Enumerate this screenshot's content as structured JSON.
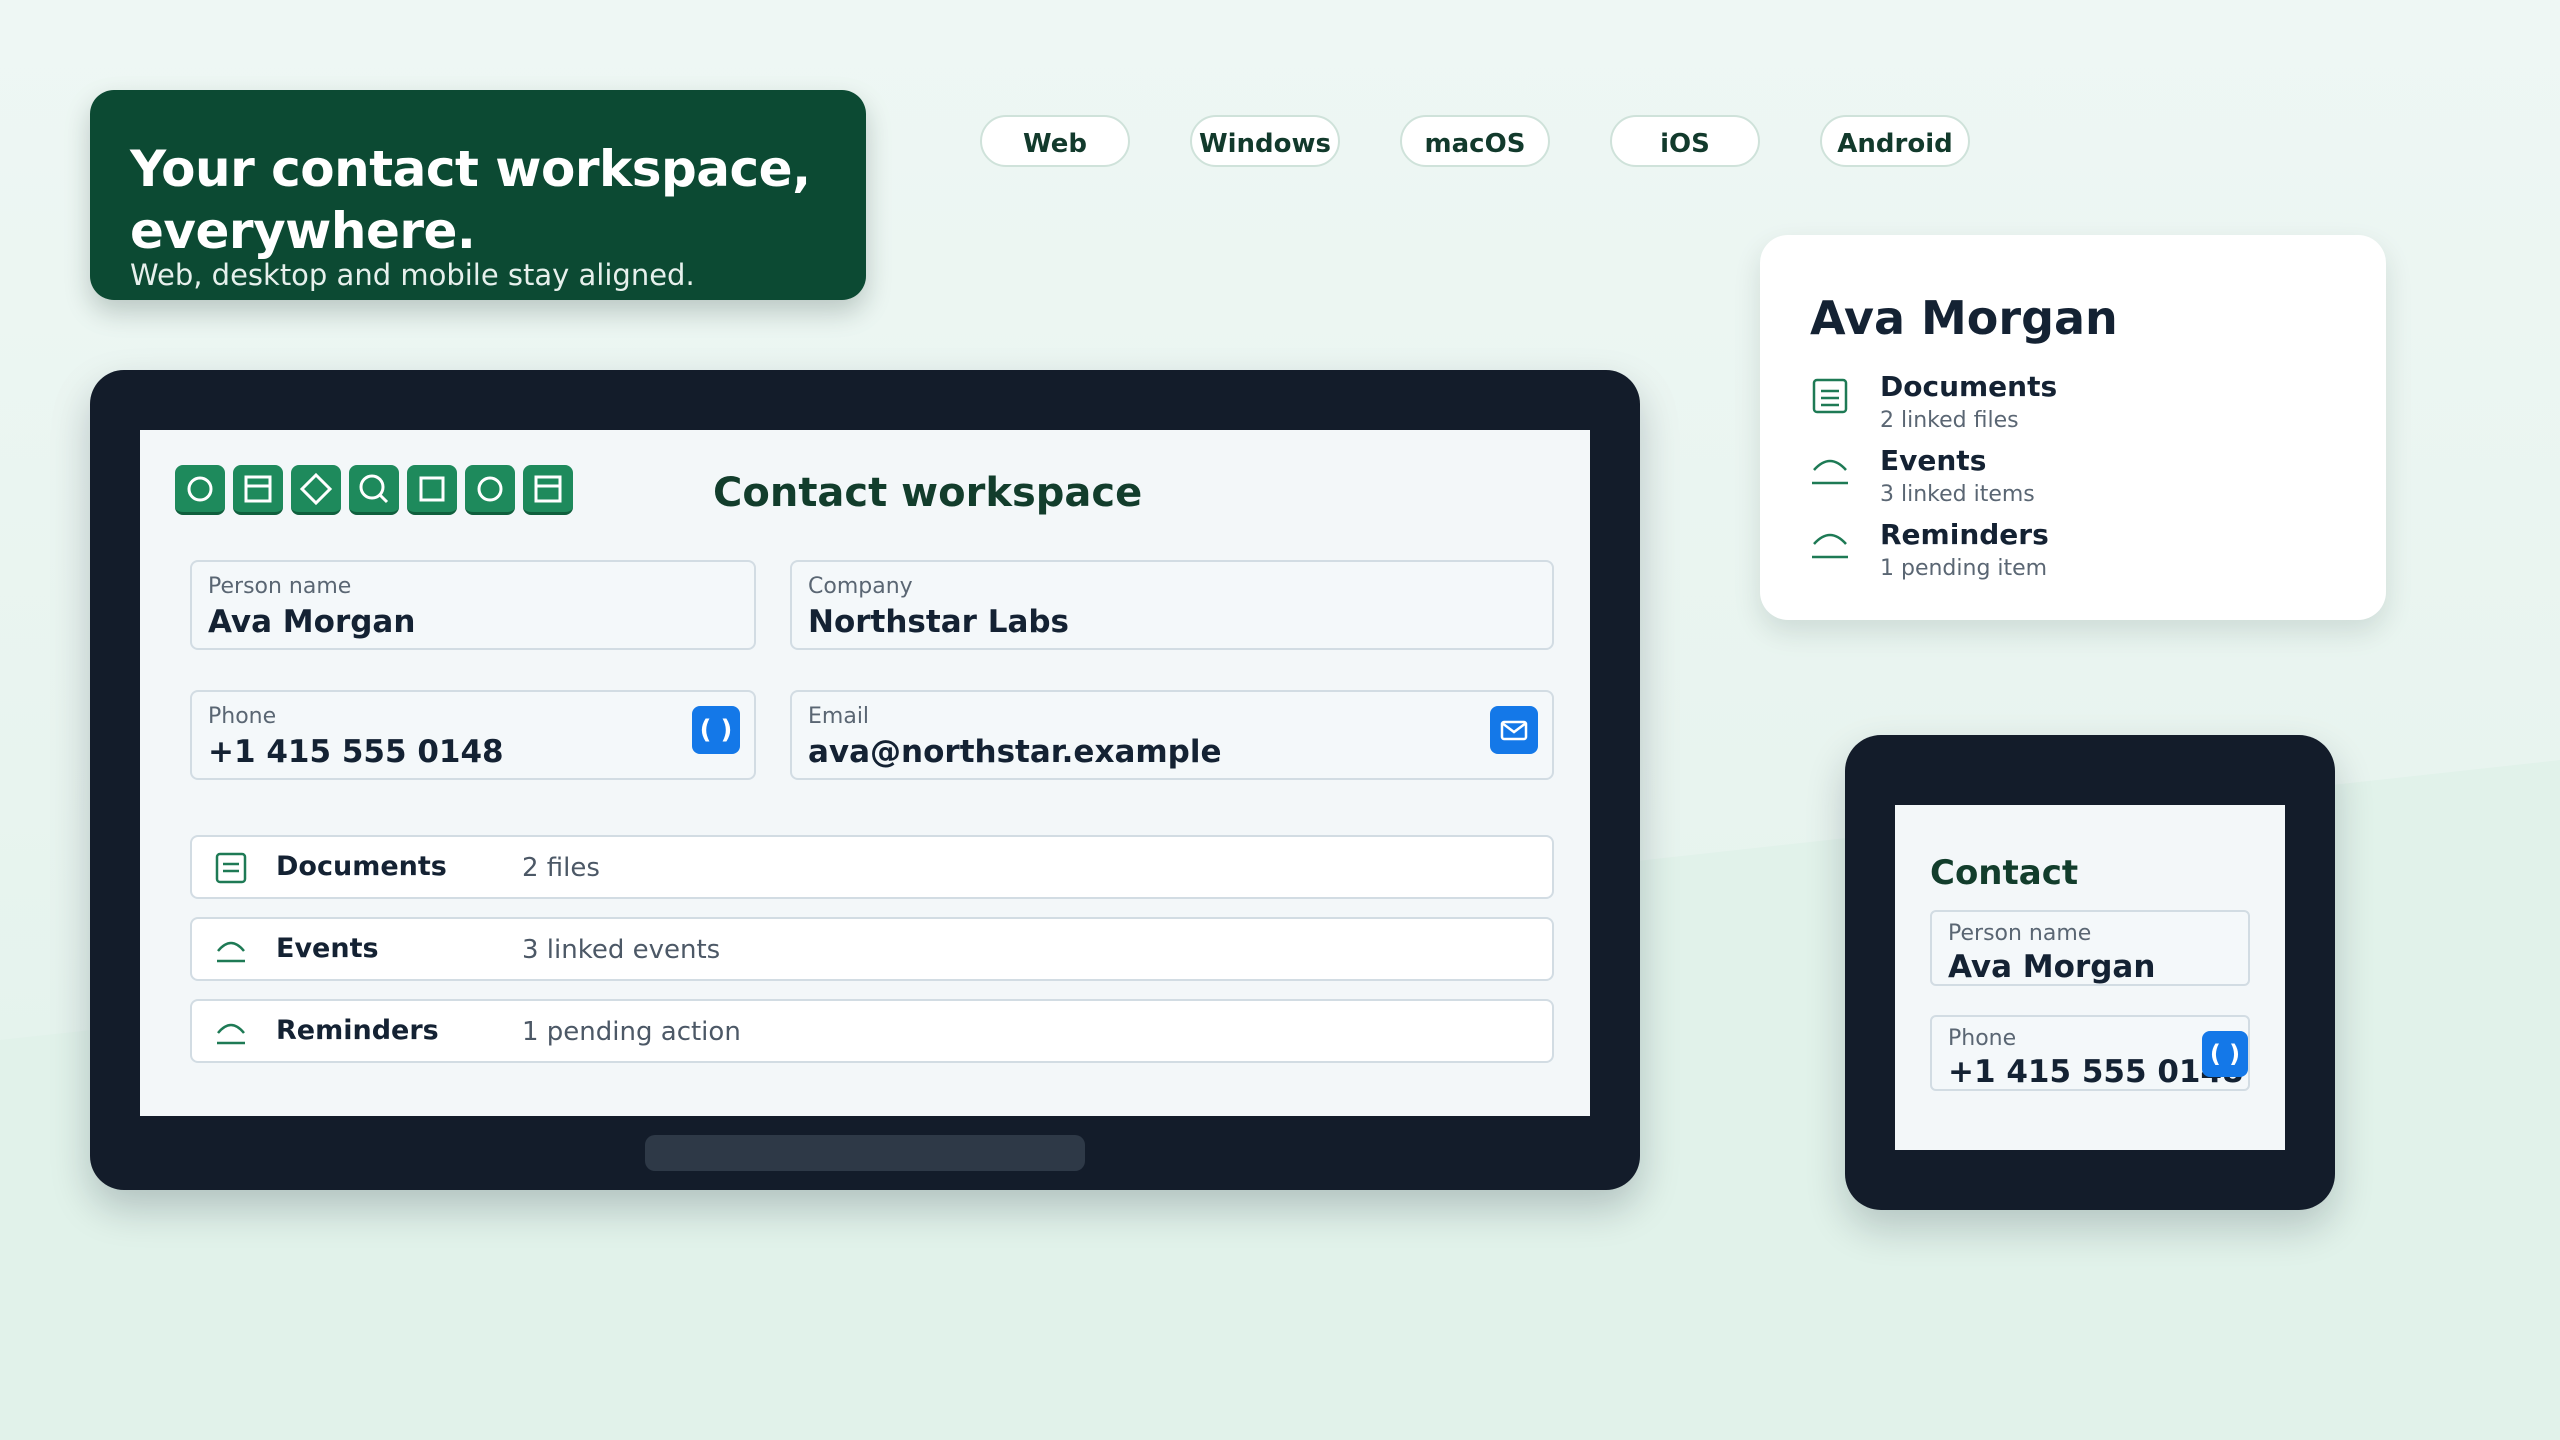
{
  "hero": {
    "title": "Your contact workspace, everywhere.",
    "subtitle": "Web, desktop and mobile stay aligned."
  },
  "platforms": [
    "Web",
    "Windows",
    "macOS",
    "iOS",
    "Android"
  ],
  "desktop": {
    "title": "Contact workspace",
    "toolbar_icons": [
      "circle-icon",
      "panel-icon",
      "diamond-icon",
      "search-icon",
      "square-icon",
      "circle-icon",
      "panel-icon"
    ],
    "fields": {
      "person": {
        "label": "Person name",
        "value": "Ava Morgan"
      },
      "company": {
        "label": "Company",
        "value": "Northstar Labs"
      },
      "phone": {
        "label": "Phone",
        "value": "+1 415 555 0148",
        "action": "( )"
      },
      "email": {
        "label": "Email",
        "value": "ava@northstar.example",
        "action_icon": "mail-icon"
      }
    },
    "rows": [
      {
        "label": "Documents",
        "value": "2 files",
        "icon": "document-icon"
      },
      {
        "label": "Events",
        "value": "3 linked events",
        "icon": "events-icon"
      },
      {
        "label": "Reminders",
        "value": "1 pending action",
        "icon": "reminder-icon"
      }
    ]
  },
  "summary_card": {
    "title": "Ava Morgan",
    "items": [
      {
        "label": "Documents",
        "sub": "2 linked files",
        "icon": "document-icon"
      },
      {
        "label": "Events",
        "sub": "3 linked items",
        "icon": "events-icon"
      },
      {
        "label": "Reminders",
        "sub": "1 pending item",
        "icon": "reminder-icon"
      }
    ]
  },
  "phone": {
    "title": "Contact",
    "fields": {
      "person": {
        "label": "Person name",
        "value": "Ava Morgan"
      },
      "phone": {
        "label": "Phone",
        "value": "+1 415 555 0148",
        "action": "( )"
      }
    }
  },
  "colors": {
    "brand": "#0c4a33",
    "accent_green": "#1e8a5c",
    "action_blue": "#1478e8",
    "device": "#131c2a"
  }
}
